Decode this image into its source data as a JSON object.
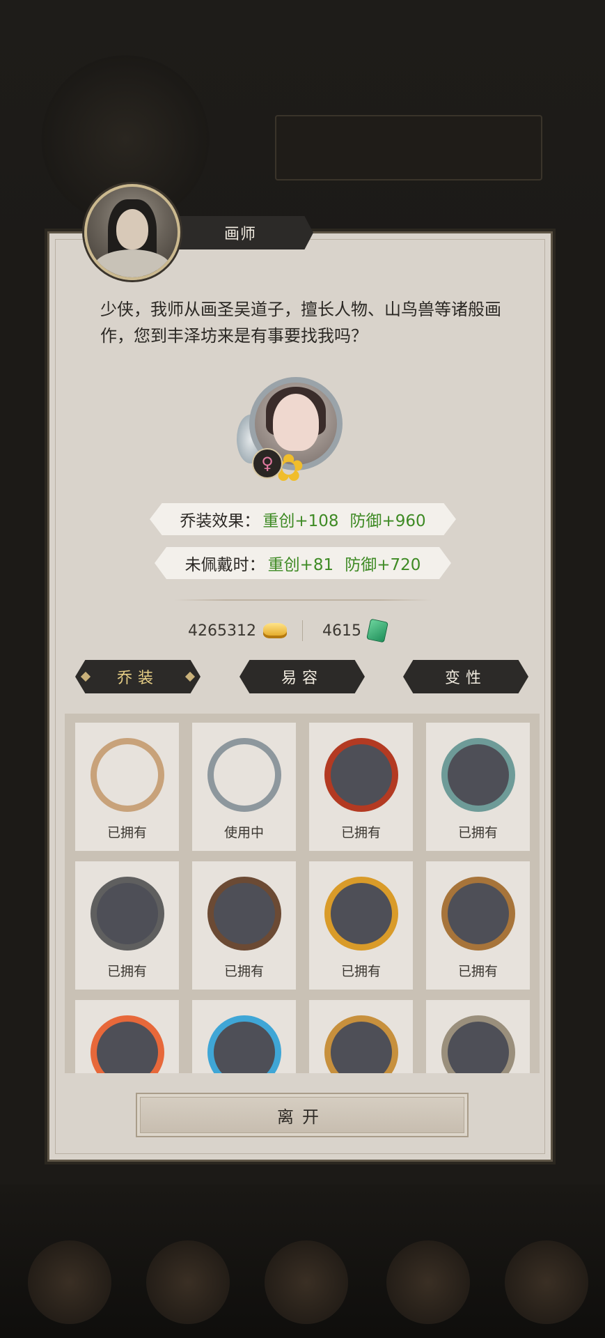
{
  "npc": {
    "name": "画师",
    "dialogue": "少侠，我师从画圣吴道子，擅长人物、山鸟兽等诸般画作，您到丰泽坊来是有事要找我吗？"
  },
  "preview": {
    "gender_symbol": "♀",
    "equip_effect": {
      "label": "乔装效果：",
      "crit": "重创+108",
      "defense": "防御+960"
    },
    "unworn_effect": {
      "label": "未佩戴时：",
      "crit": "重创+81",
      "defense": "防御+720"
    }
  },
  "currency": {
    "gold": "4265312",
    "gold_icon": "gold-ingot-icon",
    "jade": "4615",
    "jade_icon": "jade-icon"
  },
  "tabs": [
    {
      "label": "乔装",
      "active": true
    },
    {
      "label": "易容",
      "active": false
    },
    {
      "label": "变性",
      "active": false
    }
  ],
  "frames": [
    {
      "status": "已拥有",
      "color": "#c8a27a"
    },
    {
      "status": "使用中",
      "color": "#8d979d"
    },
    {
      "status": "已拥有",
      "color": "#b33a22"
    },
    {
      "status": "已拥有",
      "color": "#6e9b98"
    },
    {
      "status": "已拥有",
      "color": "#5f5f5f"
    },
    {
      "status": "已拥有",
      "color": "#6b4a34"
    },
    {
      "status": "已拥有",
      "color": "#d99b29"
    },
    {
      "status": "已拥有",
      "color": "#a7743a"
    },
    {
      "status": "",
      "color": "#e7683a"
    },
    {
      "status": "",
      "color": "#3fa6d6"
    },
    {
      "status": "",
      "color": "#c7903d"
    },
    {
      "status": "",
      "color": "#9a8f7c"
    }
  ],
  "leave_button": "离开"
}
